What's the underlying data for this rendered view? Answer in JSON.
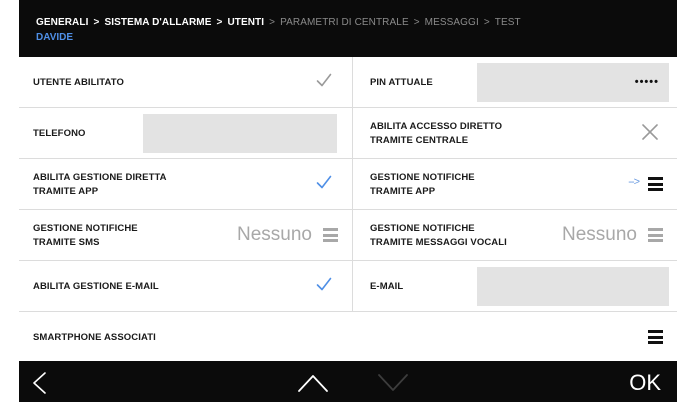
{
  "breadcrumb": {
    "items": [
      {
        "label": "GENERALI",
        "active": true
      },
      {
        "label": "SISTEMA D'ALLARME",
        "active": true
      },
      {
        "label": "UTENTI",
        "active": true
      },
      {
        "label": "PARAMETRI DI CENTRALE",
        "active": false
      },
      {
        "label": "MESSAGGI",
        "active": false
      },
      {
        "label": "TEST",
        "active": false
      }
    ],
    "separator": ">"
  },
  "user": {
    "name": "DAVIDE"
  },
  "rows": {
    "utente_abilitato": {
      "label": "UTENTE ABILITATO",
      "checked": true
    },
    "pin_attuale": {
      "label": "PIN ATTUALE",
      "value": "•••••"
    },
    "telefono": {
      "label": "TELEFONO",
      "value": ""
    },
    "accesso_diretto": {
      "label": "ABILITA ACCESSO DIRETTO\nTRAMITE CENTRALE",
      "checked": false
    },
    "gestione_diretta_app": {
      "label": "ABILITA GESTIONE DIRETTA\nTRAMITE APP",
      "checked": true
    },
    "notifiche_app": {
      "label": "GESTIONE NOTIFICHE\nTRAMITE APP",
      "hint": "-->"
    },
    "notifiche_sms": {
      "label": "GESTIONE NOTIFICHE\nTRAMITE SMS",
      "value": "Nessuno"
    },
    "notifiche_vocali": {
      "label": "GESTIONE NOTIFICHE\nTRAMITE MESSAGGI VOCALI",
      "value": "Nessuno"
    },
    "gestione_email": {
      "label": "ABILITA GESTIONE E-MAIL",
      "checked": true
    },
    "email": {
      "label": "E-MAIL",
      "value": ""
    },
    "smartphone": {
      "label": "SMARTPHONE ASSOCIATI"
    }
  },
  "footer": {
    "ok_label": "OK"
  },
  "icons": {
    "back": "chevron-left-icon",
    "up": "chevron-up-icon",
    "down": "chevron-down-icon",
    "menu": "hamburger-icon",
    "check": "checkmark-icon",
    "close": "x-icon"
  },
  "colors": {
    "header_bg": "#0b0b0b",
    "accent_blue": "#4f8fe6",
    "check_grey": "#9a9a9a",
    "muted": "#a8a8a8",
    "field_bg": "#e3e3e3"
  }
}
